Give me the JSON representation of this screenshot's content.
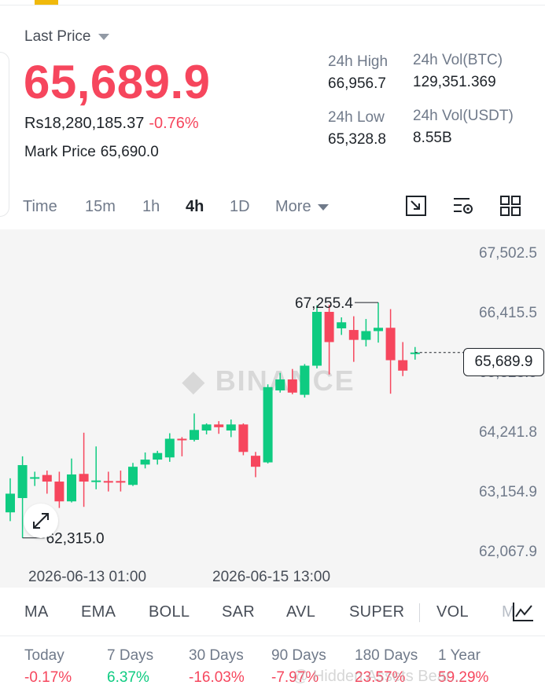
{
  "header": {
    "last_price_label": "Last Price",
    "last_price": "65,689.9",
    "fiat_price": "Rs18,280,185.37",
    "change_pct": "-0.76%",
    "mark_price_label": "Mark Price",
    "mark_price": "65,690.0"
  },
  "stats": {
    "high_label": "24h High",
    "high": "66,956.7",
    "low_label": "24h Low",
    "low": "65,328.8",
    "vol_btc_label": "24h Vol(BTC)",
    "vol_btc": "129,351.369",
    "vol_usdt_label": "24h Vol(USDT)",
    "vol_usdt": "8.55B"
  },
  "timeframes": [
    "Time",
    "15m",
    "1h",
    "4h",
    "1D",
    "More"
  ],
  "active_timeframe": "4h",
  "chart_data": {
    "type": "candlestick",
    "y_ticks": [
      "67,502.5",
      "66,415.5",
      "65,328.5",
      "64,241.8",
      "63,154.9",
      "62,067.9"
    ],
    "x_ticks": [
      "2026-06-13 01:00",
      "2026-06-15 13:00"
    ],
    "ylim": [
      62067.9,
      67502.5
    ],
    "max_label": "67,255.4",
    "min_label": "62,315.0",
    "current_price": "65,689.9",
    "watermark": "BINANCE",
    "candles": [
      {
        "o": 62780,
        "h": 63400,
        "l": 62620,
        "c": 63120
      },
      {
        "o": 63040,
        "h": 63800,
        "l": 62315,
        "c": 63640
      },
      {
        "o": 63400,
        "h": 63520,
        "l": 63260,
        "c": 63420
      },
      {
        "o": 63460,
        "h": 63540,
        "l": 63120,
        "c": 63340
      },
      {
        "o": 63340,
        "h": 63520,
        "l": 62860,
        "c": 62980
      },
      {
        "o": 62980,
        "h": 63760,
        "l": 62960,
        "c": 63470
      },
      {
        "o": 63480,
        "h": 64230,
        "l": 62880,
        "c": 63340
      },
      {
        "o": 63360,
        "h": 63980,
        "l": 63200,
        "c": 63360
      },
      {
        "o": 63350,
        "h": 63520,
        "l": 63160,
        "c": 63340
      },
      {
        "o": 63350,
        "h": 63540,
        "l": 63160,
        "c": 63340
      },
      {
        "o": 63280,
        "h": 63680,
        "l": 63260,
        "c": 63610
      },
      {
        "o": 63650,
        "h": 63870,
        "l": 63580,
        "c": 63740
      },
      {
        "o": 63740,
        "h": 63900,
        "l": 63650,
        "c": 63860
      },
      {
        "o": 63780,
        "h": 64220,
        "l": 63700,
        "c": 64120
      },
      {
        "o": 64120,
        "h": 64150,
        "l": 63800,
        "c": 64110
      },
      {
        "o": 64100,
        "h": 64580,
        "l": 64070,
        "c": 64280
      },
      {
        "o": 64270,
        "h": 64400,
        "l": 64200,
        "c": 64380
      },
      {
        "o": 64380,
        "h": 64440,
        "l": 64210,
        "c": 64330
      },
      {
        "o": 64270,
        "h": 64470,
        "l": 64150,
        "c": 64380
      },
      {
        "o": 64380,
        "h": 64400,
        "l": 63820,
        "c": 63880
      },
      {
        "o": 63810,
        "h": 63880,
        "l": 63420,
        "c": 63610
      },
      {
        "o": 63690,
        "h": 65110,
        "l": 63670,
        "c": 65060
      },
      {
        "o": 65000,
        "h": 65320,
        "l": 64960,
        "c": 65200
      },
      {
        "o": 65200,
        "h": 65390,
        "l": 64930,
        "c": 64960
      },
      {
        "o": 64920,
        "h": 65480,
        "l": 64870,
        "c": 65450
      },
      {
        "o": 65450,
        "h": 66550,
        "l": 65400,
        "c": 66430
      },
      {
        "o": 66430,
        "h": 66560,
        "l": 65290,
        "c": 65880
      },
      {
        "o": 66130,
        "h": 66330,
        "l": 66010,
        "c": 66240
      },
      {
        "o": 66100,
        "h": 66350,
        "l": 65520,
        "c": 65920
      },
      {
        "o": 65920,
        "h": 66300,
        "l": 65800,
        "c": 66080
      },
      {
        "o": 66080,
        "h": 66600,
        "l": 65870,
        "c": 66140
      },
      {
        "o": 66140,
        "h": 66480,
        "l": 64940,
        "c": 65550
      },
      {
        "o": 65550,
        "h": 65880,
        "l": 65260,
        "c": 65360
      },
      {
        "o": 65680,
        "h": 65790,
        "l": 65560,
        "c": 65690
      }
    ]
  },
  "indicators": [
    "MA",
    "EMA",
    "BOLL",
    "SAR",
    "AVL",
    "SUPER",
    "VOL",
    "M"
  ],
  "performance": [
    {
      "label": "Today",
      "value": "-0.17%",
      "dir": "down"
    },
    {
      "label": "7 Days",
      "value": "6.37%",
      "dir": "up"
    },
    {
      "label": "30 Days",
      "value": "-16.03%",
      "dir": "down"
    },
    {
      "label": "90 Days",
      "value": "-7.97%",
      "dir": "down"
    },
    {
      "label": "180 Days",
      "value": "23.57%",
      "dir": "down"
    },
    {
      "label": "1 Year",
      "value": "59.29%",
      "dir": "down"
    }
  ],
  "overlay_watermark": "@ Hidden Assets Bear...",
  "colors": {
    "up": "#0ecb81",
    "down": "#f6465d",
    "accent": "#f0b90b"
  }
}
